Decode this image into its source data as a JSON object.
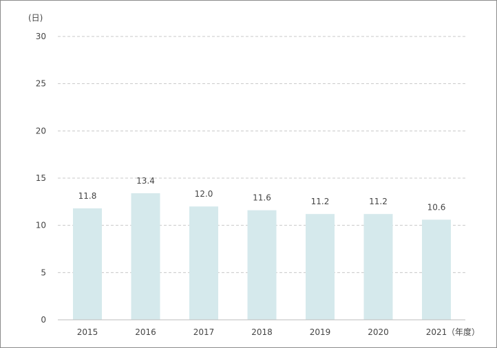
{
  "chart_data": {
    "type": "bar",
    "y_unit_label": "(日)",
    "x_unit_label": "（年度）",
    "categories": [
      "2015",
      "2016",
      "2017",
      "2018",
      "2019",
      "2020",
      "2021"
    ],
    "values": [
      11.8,
      13.4,
      12.0,
      11.6,
      11.2,
      11.2,
      10.6
    ],
    "value_labels": [
      "11.8",
      "13.4",
      "12.0",
      "11.6",
      "11.2",
      "11.2",
      "10.6"
    ],
    "ylim": [
      0,
      30
    ],
    "yticks": [
      0,
      5,
      10,
      15,
      20,
      25,
      30
    ],
    "grid": true,
    "bar_color": "#d5e9ec",
    "grid_color": "#c8c8c8",
    "text_color": "#444444"
  }
}
